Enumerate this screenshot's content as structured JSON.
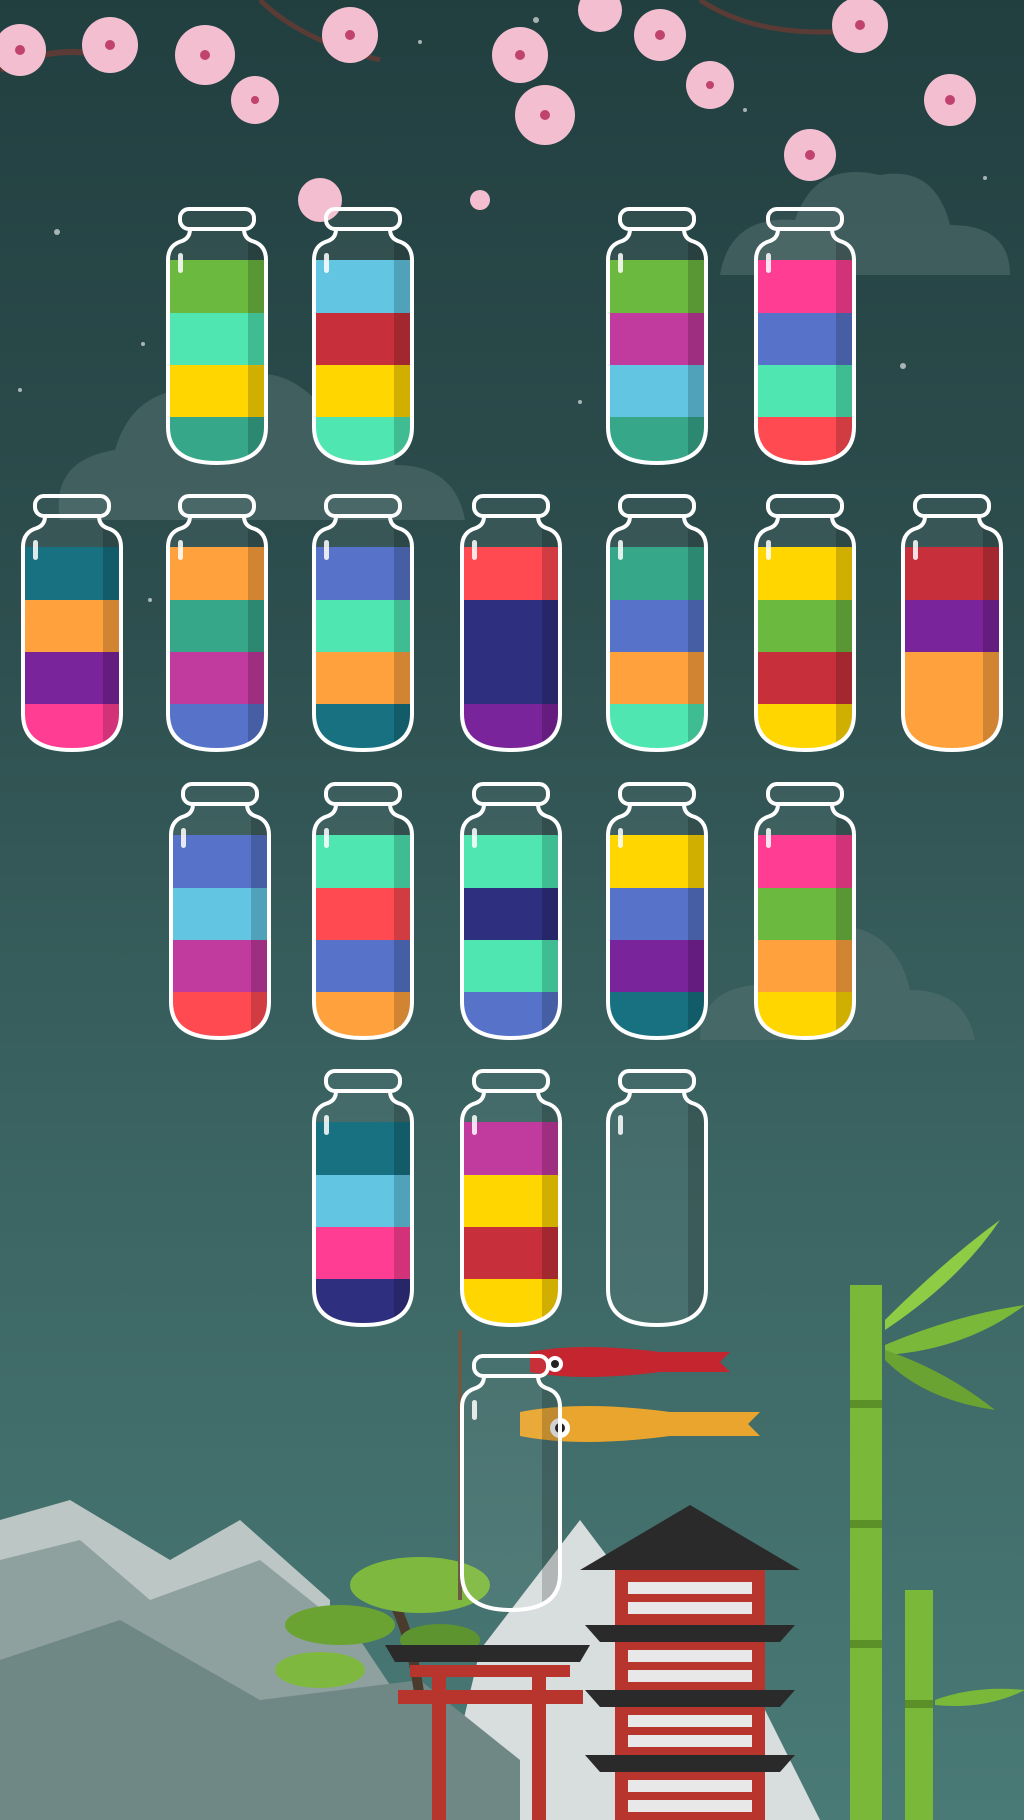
{
  "palette": {
    "green": "#6cb93f",
    "mint": "#4fe6b2",
    "yellow": "#ffd600",
    "teal": "#36a789",
    "sky": "#62c6e3",
    "red": "#c7303a",
    "magenta": "#c13a9d",
    "pink": "#ff3e93",
    "blue": "#5673c9",
    "coral": "#ff4a52",
    "darkteal": "#177180",
    "orange": "#ffa23e",
    "purple": "#7a249b",
    "navy": "#2f2f80"
  },
  "tubes": [
    {
      "id": "tube-1",
      "layers": [
        "green",
        "mint",
        "yellow",
        "teal"
      ]
    },
    {
      "id": "tube-2",
      "layers": [
        "sky",
        "red",
        "yellow",
        "mint"
      ]
    },
    {
      "id": "tube-3",
      "layers": [
        "green",
        "magenta",
        "sky",
        "teal"
      ]
    },
    {
      "id": "tube-4",
      "layers": [
        "pink",
        "blue",
        "mint",
        "coral"
      ]
    },
    {
      "id": "tube-5",
      "layers": [
        "darkteal",
        "orange",
        "purple",
        "pink"
      ]
    },
    {
      "id": "tube-6",
      "layers": [
        "orange",
        "teal",
        "magenta",
        "blue"
      ]
    },
    {
      "id": "tube-7",
      "layers": [
        "blue",
        "mint",
        "orange",
        "darkteal"
      ]
    },
    {
      "id": "tube-8",
      "layers": [
        "coral",
        "navy",
        "navy",
        "purple"
      ]
    },
    {
      "id": "tube-9",
      "layers": [
        "teal",
        "blue",
        "orange",
        "mint"
      ]
    },
    {
      "id": "tube-10",
      "layers": [
        "yellow",
        "green",
        "red",
        "yellow"
      ]
    },
    {
      "id": "tube-11",
      "layers": [
        "red",
        "purple",
        "orange",
        "orange"
      ]
    },
    {
      "id": "tube-12",
      "layers": [
        "blue",
        "sky",
        "magenta",
        "coral"
      ]
    },
    {
      "id": "tube-13",
      "layers": [
        "mint",
        "coral",
        "blue",
        "orange"
      ]
    },
    {
      "id": "tube-14",
      "layers": [
        "mint",
        "navy",
        "mint",
        "blue"
      ]
    },
    {
      "id": "tube-15",
      "layers": [
        "yellow",
        "blue",
        "purple",
        "darkteal"
      ]
    },
    {
      "id": "tube-16",
      "layers": [
        "pink",
        "green",
        "orange",
        "yellow"
      ]
    },
    {
      "id": "tube-17",
      "layers": [
        "darkteal",
        "sky",
        "pink",
        "navy"
      ]
    },
    {
      "id": "tube-18",
      "layers": [
        "magenta",
        "yellow",
        "red",
        "yellow"
      ]
    },
    {
      "id": "tube-19",
      "layers": []
    },
    {
      "id": "tube-20",
      "layers": []
    }
  ],
  "colors": {
    "tube_outline": "#ffffff",
    "blossom": "#f3bfd0",
    "blossom_center": "#c0426e",
    "bamboo": "#7ab83a",
    "pagoda_red": "#b8352d",
    "pagoda_roof": "#2a2a2a",
    "mountain": "#c9d1cf",
    "koi_red": "#c4252f",
    "koi_gold": "#e9a52d"
  }
}
